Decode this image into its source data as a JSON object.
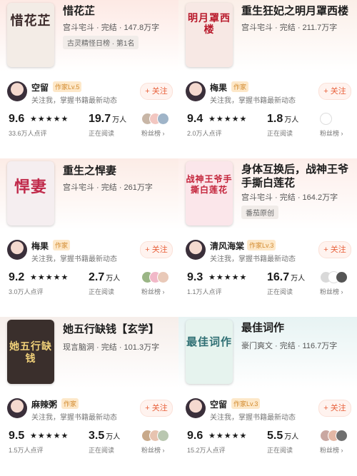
{
  "cards": [
    {
      "title": "惜花芷",
      "meta": "宫斗宅斗 · 完结 · 147.8万字",
      "rank": "古灵精怪日榜 · 第1名",
      "cover_text": "惜花芷",
      "author": "空留",
      "author_badge": "作家Lv.5",
      "author_sub": "关注我，掌握书籍最新动态",
      "follow": "+ 关注",
      "score": "9.6",
      "reviews": "33.6万人点评",
      "reading": "19.7",
      "reading_unit": "万人",
      "reading_label": "正在阅读",
      "fans_label": "粉丝榜 ›",
      "bg": "#fde9e4",
      "cover_bg": "#f3ece6",
      "cover_color": "#3b2a2a",
      "rating": 4.5
    },
    {
      "title": "重生狂妃之明月罩西楼",
      "meta": "宫斗宅斗 · 完结 · 211.7万字",
      "rank": "",
      "cover_text": "明月罩西楼",
      "author": "梅果",
      "author_badge": "作家",
      "author_sub": "关注我，掌握书籍最新动态",
      "follow": "+ 关注",
      "score": "9.4",
      "reviews": "2.0万人点评",
      "reading": "1.8",
      "reading_unit": "万人",
      "reading_label": "正在阅读",
      "fans_label": "粉丝榜 ›",
      "bg": "#fbefe8",
      "cover_bg": "#f7e8e4",
      "cover_color": "#b8182a",
      "rating": 4.5
    },
    {
      "title": "重生之悍妻",
      "meta": "宫斗宅斗 · 完结 · 261万字",
      "rank": "",
      "cover_text": "悍妻",
      "author": "梅果",
      "author_badge": "作家",
      "author_sub": "关注我，掌握书籍最新动态",
      "follow": "+ 关注",
      "score": "9.2",
      "reviews": "3.0万人点评",
      "reading": "2.7",
      "reading_unit": "万人",
      "reading_label": "正在阅读",
      "fans_label": "粉丝榜 ›",
      "bg": "#fcece6",
      "cover_bg": "#f5eef0",
      "cover_color": "#c0294a",
      "rating": 4.5
    },
    {
      "title": "身体互换后，战神王爷手撕白莲花",
      "meta": "宫斗宅斗 · 完结 · 164.2万字",
      "rank": "番茄原创",
      "cover_text": "战神王爷手撕白莲花",
      "author": "清风海棠",
      "author_badge": "作家Lv.3",
      "author_sub": "关注我，掌握书籍最新动态",
      "follow": "+ 关注",
      "score": "9.3",
      "reviews": "1.1万人点评",
      "reading": "16.7",
      "reading_unit": "万人",
      "reading_label": "正在阅读",
      "fans_label": "粉丝榜 ›",
      "bg": "#fdeeea",
      "cover_bg": "#fbe6ea",
      "cover_color": "#c3233a",
      "rating": 4.5
    },
    {
      "title": "她五行缺钱【玄学】",
      "meta": "现言脑洞 · 完结 · 101.3万字",
      "rank": "",
      "cover_text": "她五行缺钱",
      "author": "麻辣粥",
      "author_badge": "作家",
      "author_sub": "关注我，掌握书籍最新动态",
      "follow": "+ 关注",
      "score": "9.5",
      "reviews": "1.5万人点评",
      "reading": "3.5",
      "reading_unit": "万人",
      "reading_label": "正在阅读",
      "fans_label": "粉丝榜 ›",
      "bg": "#f6eeea",
      "cover_bg": "#3a2f2c",
      "cover_color": "#f2d27a",
      "rating": 4.5
    },
    {
      "title": "最佳词作",
      "meta": "豪门爽文 · 完结 · 116.7万字",
      "rank": "",
      "cover_text": "最佳词作",
      "author": "空留",
      "author_badge": "作家Lv.3",
      "author_sub": "关注我，掌握书籍最新动态",
      "follow": "+ 关注",
      "score": "9.6",
      "reviews": "15.2万人点评",
      "reading": "5.5",
      "reading_unit": "万人",
      "reading_label": "正在阅读",
      "fans_label": "粉丝榜 ›",
      "bg": "#e7f3f3",
      "cover_bg": "#e6f3ee",
      "cover_color": "#2f6f73",
      "rating": 4.5
    }
  ],
  "colors": {
    "accent": "#e8613c",
    "star": "#1b1b1b"
  }
}
